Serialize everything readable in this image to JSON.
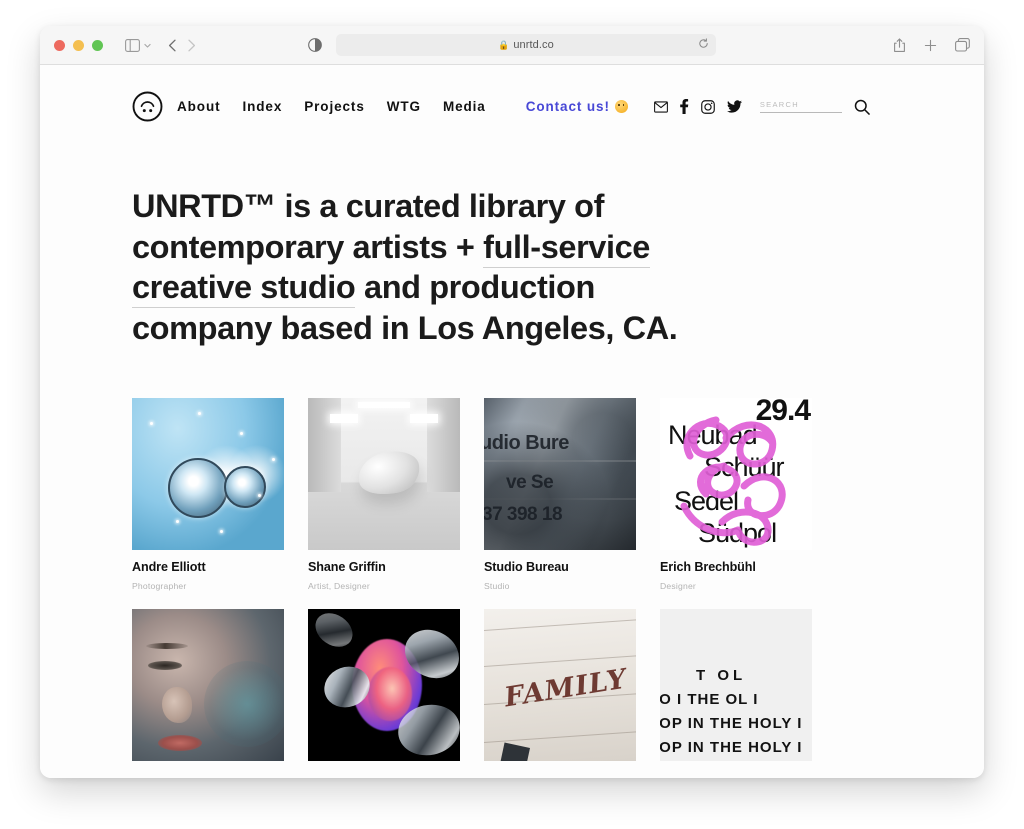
{
  "browser": {
    "url": "unrtd.co",
    "lock_icon": "lock-icon",
    "traffic_lights": [
      "close-button",
      "minimize-button",
      "maximize-button"
    ],
    "controls": {
      "sidebar": "sidebar-toggle-icon",
      "sidebar_chevron": "chevron-down-icon",
      "back": "back-arrow-icon",
      "forward": "forward-arrow-icon",
      "reader": "reader-view-icon",
      "reload": "reload-icon",
      "share": "share-icon",
      "new_tab": "plus-icon",
      "tabs_overview": "tabs-overview-icon"
    }
  },
  "site": {
    "logo_alt": "unrtd-face-logo",
    "nav": [
      {
        "label": "About"
      },
      {
        "label": "Index"
      },
      {
        "label": "Projects"
      },
      {
        "label": "WTG"
      },
      {
        "label": "Media"
      }
    ],
    "contact": {
      "label": "Contact us!",
      "emoji": "smiling-face-emoji"
    },
    "social": [
      {
        "name": "email-icon"
      },
      {
        "name": "facebook-icon"
      },
      {
        "name": "instagram-icon"
      },
      {
        "name": "twitter-icon"
      }
    ],
    "search": {
      "value": "",
      "placeholder": "SEARCH",
      "button": "search-icon"
    },
    "accent_color": "#4848d6",
    "text_color": "#1b1b1b"
  },
  "hero": {
    "part1": "UNRTD™ is a curated library of contemporary artists + ",
    "underline1": "full-service creative studio",
    "part2": " and production company based in Los Angeles, CA."
  },
  "cards": [
    {
      "title": "Andre Elliott",
      "subtitle": "Photographer",
      "art": "car-headlight-photo"
    },
    {
      "title": "Shane Griffin",
      "subtitle": "Artist, Designer",
      "art": "sneaker-gallery-render"
    },
    {
      "title": "Studio Bureau",
      "subtitle": "Studio",
      "art": "denim-jacket-typography"
    },
    {
      "title": "Erich Brechbühl",
      "subtitle": "Designer",
      "art": "pink-script-poster"
    },
    {
      "title": "",
      "subtitle": "",
      "art": "portrait-photo"
    },
    {
      "title": "",
      "subtitle": "",
      "art": "glossy-3d-render"
    },
    {
      "title": "",
      "subtitle": "",
      "art": "family-wall-photo"
    },
    {
      "title": "",
      "subtitle": "",
      "art": "holy-typography-poster"
    }
  ],
  "artwork_text": {
    "denim": [
      "udio Bure",
      "ve Se",
      "37 398 18"
    ],
    "poster": [
      "29.4",
      "Neubad",
      "Schüür",
      "Sedel",
      "Südpol"
    ],
    "family": "FAMILY",
    "typo": [
      "T        OL",
      "IO  I   THE    OL   I",
      "IOP IN THE HOLY I",
      "IOP IN THE HOLY I"
    ]
  }
}
